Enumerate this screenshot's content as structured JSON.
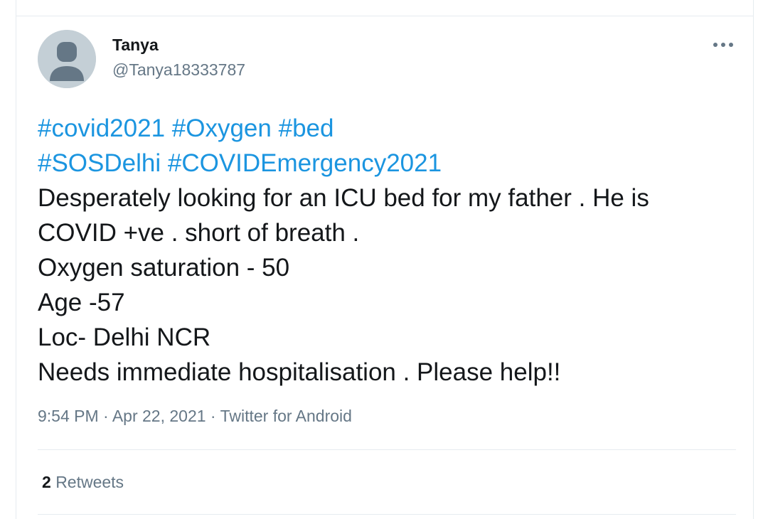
{
  "author": {
    "name": "Tanya",
    "handle": "@Tanya18333787"
  },
  "tweet": {
    "hashtags_line1": [
      "#covid2021",
      "#Oxygen",
      "#bed"
    ],
    "hashtags_line2": [
      "#SOSDelhi",
      "#COVIDEmergency2021"
    ],
    "text_lines": [
      "Desperately looking for an ICU bed for my father . He is",
      "COVID +ve . short of breath .",
      "Oxygen saturation - 50",
      "Age -57",
      "Loc- Delhi NCR",
      "Needs immediate hospitalisation . Please help!!"
    ]
  },
  "meta": {
    "time": "9:54 PM",
    "separator": " · ",
    "date": "Apr 22, 2021",
    "source": "Twitter for Android"
  },
  "stats": {
    "retweets_count": "2",
    "retweets_label": "Retweets"
  },
  "icons": {
    "avatar": "default-avatar-icon",
    "more": "more-horizontal-icon"
  },
  "colors": {
    "hashtag": "#1b95e0",
    "text": "#14171a",
    "muted": "#657786",
    "divider": "#e6ecf0",
    "avatar_bg": "#c4cfd6"
  }
}
